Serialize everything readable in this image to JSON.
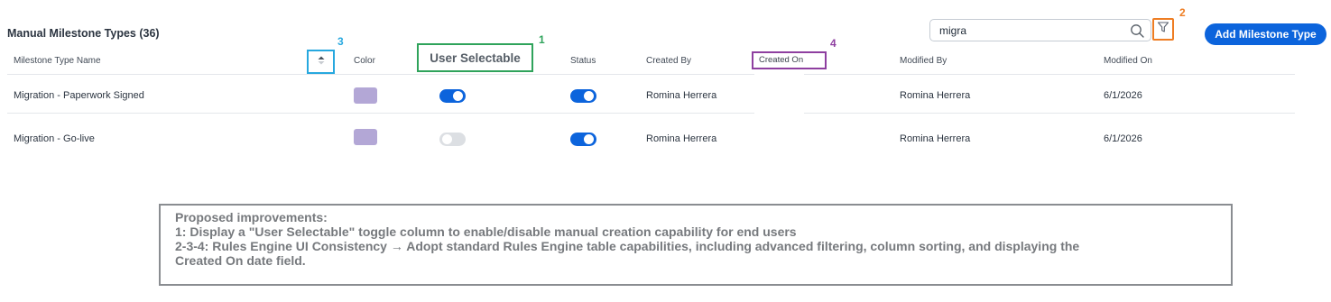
{
  "page": {
    "title": "Manual Milestone Types (36)"
  },
  "search": {
    "value": "migra",
    "icon": "search-icon"
  },
  "toolbar": {
    "filter_icon": "filter-icon",
    "add_label": "Add Milestone Type"
  },
  "table": {
    "columns": [
      "Milestone Type Name",
      "Color",
      "User Selectable",
      "Status",
      "Created By",
      "Created On",
      "Modified By",
      "Modified On"
    ],
    "sort_icon": "sort-ascending-icon",
    "rows": [
      {
        "name": "Migration - Paperwork Signed",
        "color": "#b3a7d6",
        "user_selectable": true,
        "status": true,
        "created_by": "Romina Herrera",
        "created_on": "",
        "modified_by": "Romina Herrera",
        "modified_on": "6/1/2026"
      },
      {
        "name": "Migration - Go-live",
        "color": "#b3a7d6",
        "user_selectable": false,
        "status": true,
        "created_by": "Romina Herrera",
        "created_on": "",
        "modified_by": "Romina Herrera",
        "modified_on": "6/1/2026"
      }
    ]
  },
  "callouts": {
    "user_selectable": "1",
    "filter": "2",
    "sort": "3",
    "created_on": "4"
  },
  "annotation_colors": {
    "green": "#2fa35b",
    "orange": "#ee7d23",
    "blue": "#27a8df",
    "purple": "#8e3fa0"
  },
  "notes": {
    "heading": "Proposed improvements:",
    "lines": [
      "1: Display a \"User Selectable\" toggle column to enable/disable manual creation capability for end users",
      "2-3-4: Rules Engine UI Consistency → Adopt standard Rules Engine table capabilities, including advanced filtering, column sorting, and displaying the",
      "Created On date field."
    ]
  }
}
